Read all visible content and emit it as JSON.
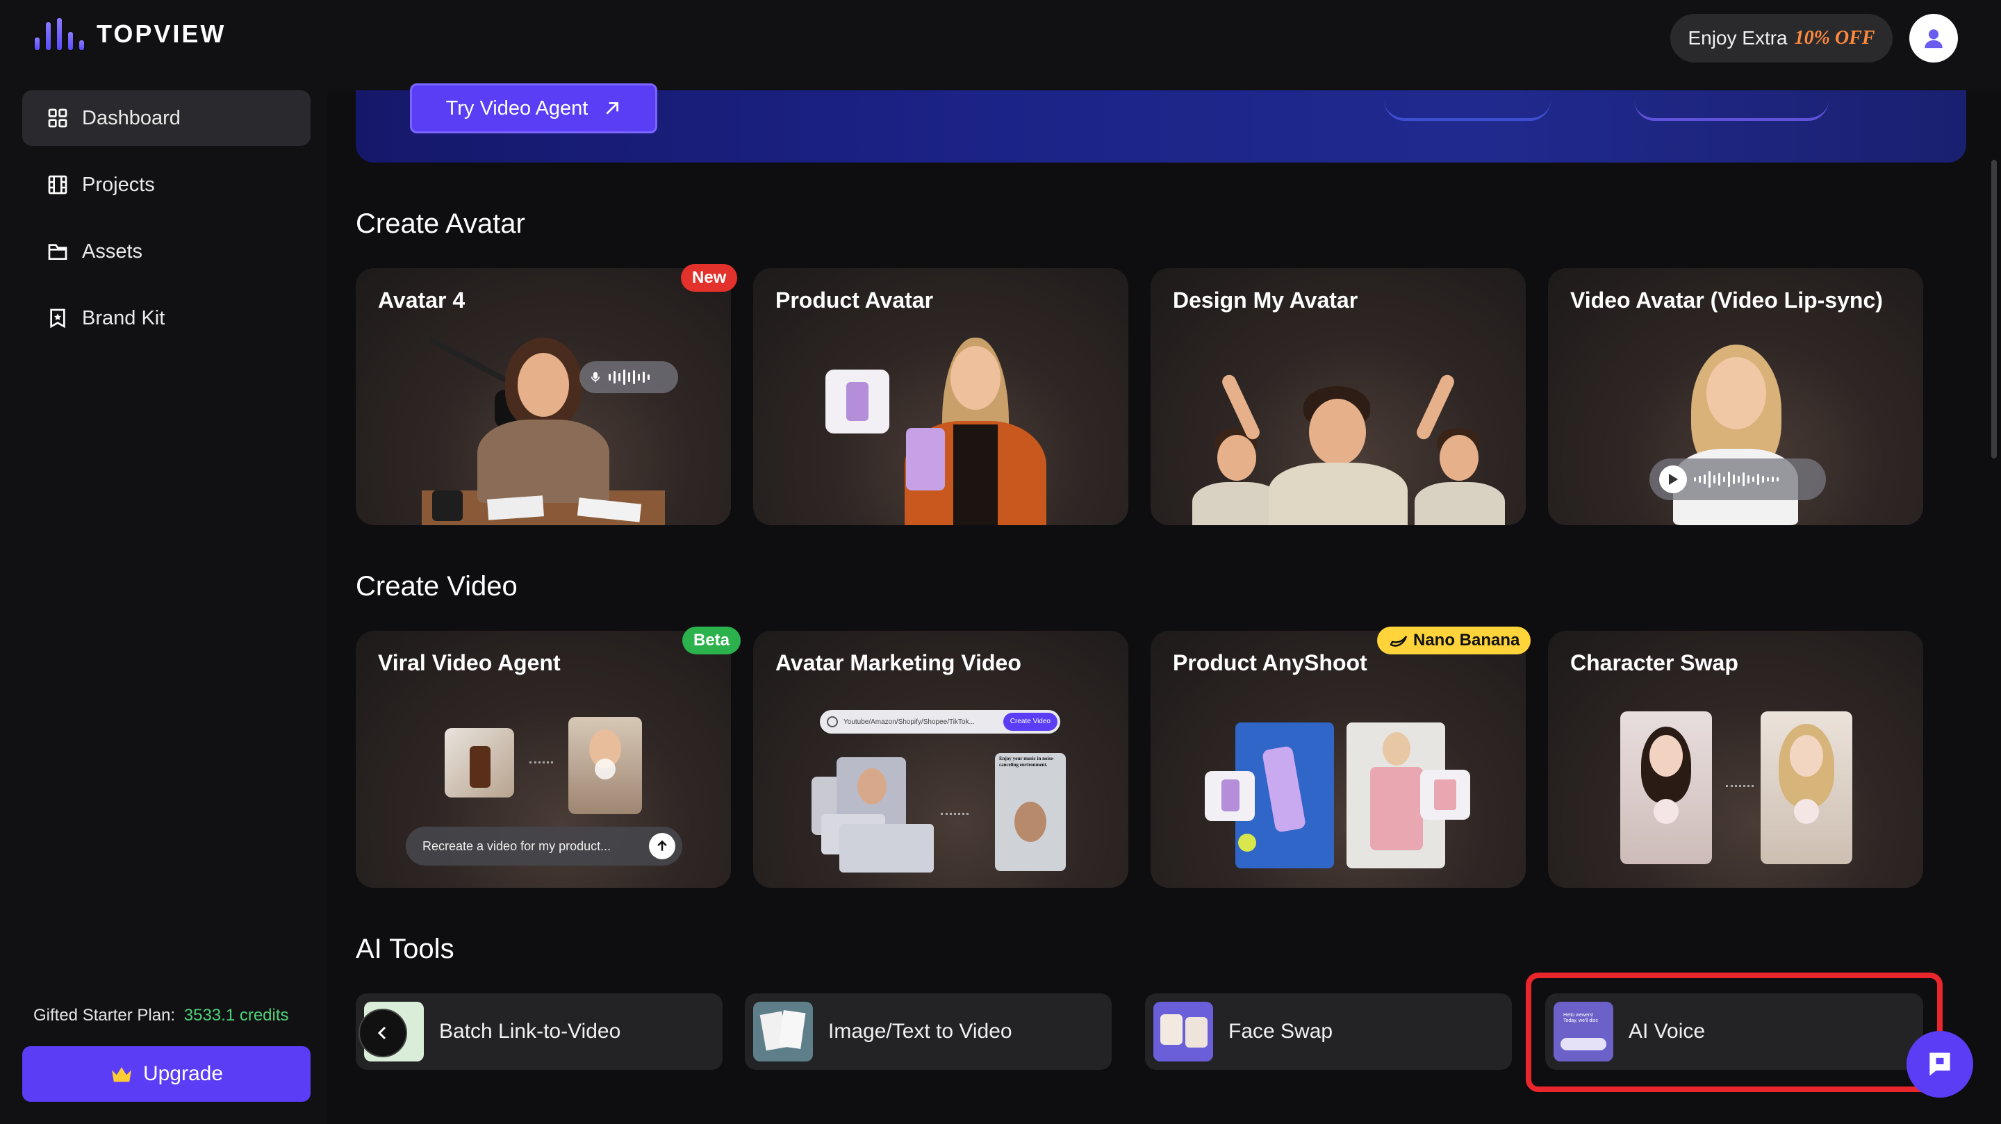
{
  "app": {
    "brand": "TOPVIEW"
  },
  "header": {
    "promo_prefix": "Enjoy Extra",
    "promo_highlight": "10% OFF",
    "profile_icon": "user-icon"
  },
  "sidebar": {
    "items": [
      {
        "label": "Dashboard",
        "icon": "dashboard-grid-icon",
        "active": true
      },
      {
        "label": "Projects",
        "icon": "film-icon",
        "active": false
      },
      {
        "label": "Assets",
        "icon": "folder-icon",
        "active": false
      },
      {
        "label": "Brand Kit",
        "icon": "star-bookmark-icon",
        "active": false
      }
    ],
    "plan_label": "Gifted Starter Plan:",
    "plan_credits": "3533.1 credits",
    "upgrade_label": "Upgrade"
  },
  "banner": {
    "cta_label": "Try Video Agent"
  },
  "sections": {
    "avatar": {
      "title": "Create Avatar",
      "cards": [
        {
          "title": "Avatar 4",
          "badge": "New"
        },
        {
          "title": "Product Avatar"
        },
        {
          "title": "Design My Avatar"
        },
        {
          "title": "Video Avatar (Video Lip-sync)"
        }
      ]
    },
    "video": {
      "title": "Create Video",
      "cards": [
        {
          "title": "Viral Video Agent",
          "badge": "Beta",
          "prompt_text": "Recreate a video for my product..."
        },
        {
          "title": "Avatar Marketing Video",
          "url_text": "Youtube/Amazon/Shopify/Shopee/TikTok...",
          "url_button": "Create Video",
          "caption": "Enjoy your music in noise-canceling environment."
        },
        {
          "title": "Product AnyShoot",
          "badge": "Nano Banana"
        },
        {
          "title": "Character Swap"
        }
      ]
    },
    "tools": {
      "title": "AI Tools",
      "items": [
        {
          "label": "Batch Link-to-Video"
        },
        {
          "label": "Image/Text to Video"
        },
        {
          "label": "Face Swap"
        },
        {
          "label": "AI Voice",
          "thumb_text": "Hello viewers! Today, we'll disc"
        }
      ]
    }
  },
  "colors": {
    "accent": "#5b3df6",
    "new_badge": "#e3322c",
    "beta_badge": "#2bb24c",
    "nano_badge": "#ffd43a",
    "credits": "#4ed37a",
    "highlight": "#e8262b"
  }
}
